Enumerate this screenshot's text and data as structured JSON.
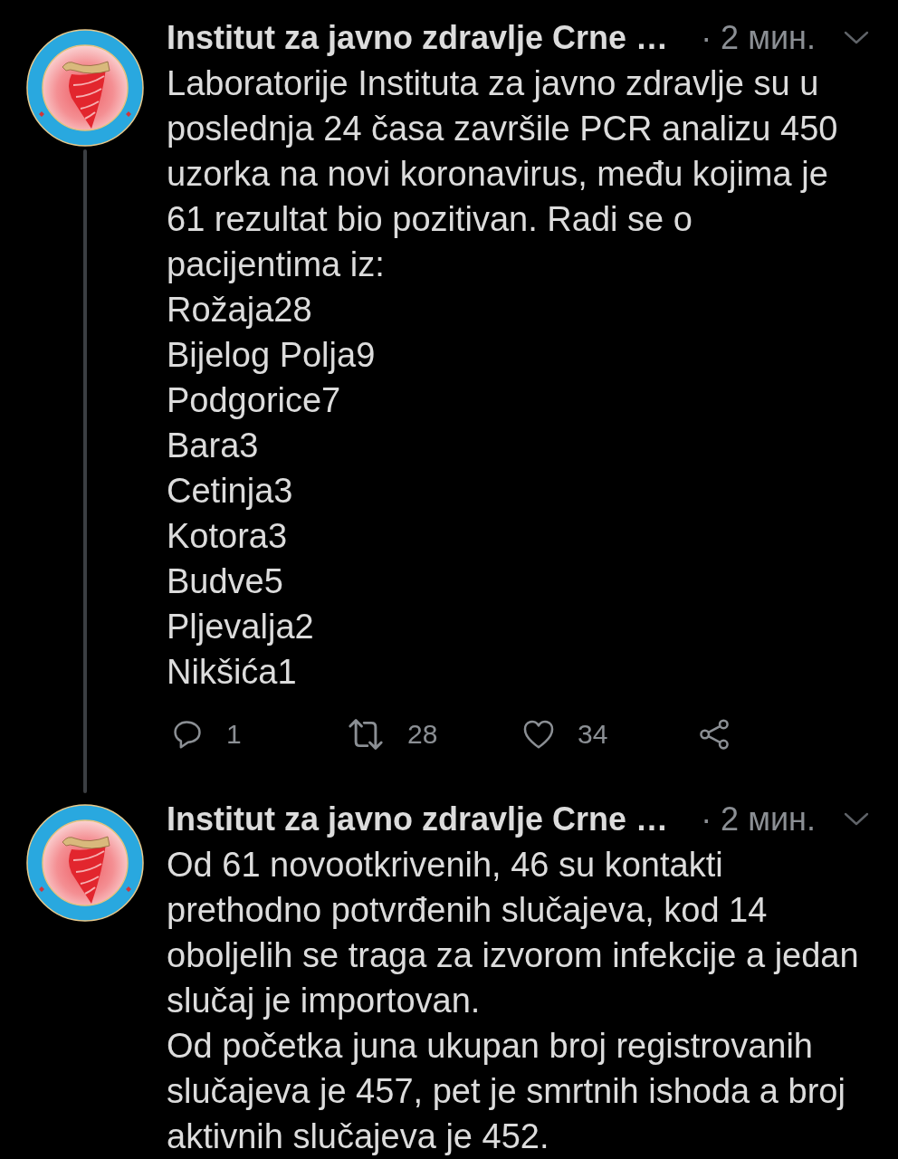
{
  "tweets": [
    {
      "author": "Institut za javno zdravlje Crne …",
      "time": "· 2 мин.",
      "thread_continues": true,
      "lines": [
        "Laboratorije Instituta za javno zdravlje su u poslednja 24 časa završile PCR analizu 450 uzorka na novi koronavirus, među kojima je 61 rezultat bio pozitivan. Radi se o pacijentima iz:",
        "Rožaja28",
        "Bijelog Polja9",
        "Podgorice7",
        "Bara3",
        "Cetinja3",
        "Kotora3",
        "Budve5",
        "Pljevalja2",
        "Nikšića1"
      ],
      "actions": [
        {
          "kind": "reply",
          "count": "1"
        },
        {
          "kind": "retweet",
          "count": "28"
        },
        {
          "kind": "like",
          "count": "34"
        },
        {
          "kind": "share"
        }
      ]
    },
    {
      "author": "Institut za javno zdravlje Crne …",
      "time": "· 2 мин.",
      "thread_continues": false,
      "lines": [
        "Od 61 novootkrivenih, 46 su kontakti prethodno potvrđenih slučajeva, kod 14 oboljelih se traga za izvorom infekcije a jedan slučaj je importovan.",
        "Od početka juna ukupan broj registrovanih slučajeva je 457, pet je smrtnih ishoda a broj aktivnih slučajeva je 452."
      ]
    }
  ]
}
